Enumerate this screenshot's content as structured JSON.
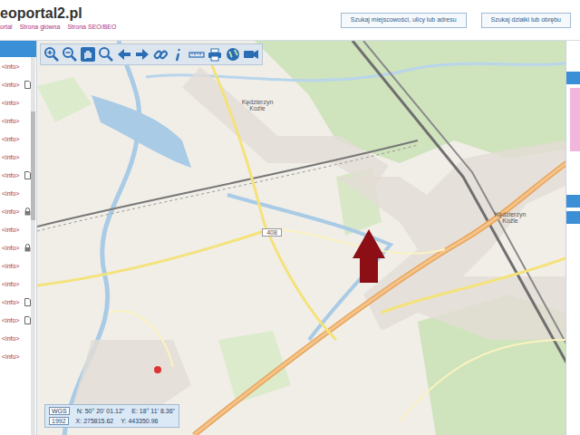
{
  "header": {
    "logo": "eoportal2.pl",
    "links": [
      "ortal",
      "Strona główna",
      "Strona SEO/BEO"
    ]
  },
  "search_buttons": [
    "Szukaj miejscowości, ulicy lub adresu",
    "Szukaj działki lub obrębu"
  ],
  "sidebar": {
    "items": [
      {
        "label": "<info>",
        "kind": "plain"
      },
      {
        "label": "<info>",
        "kind": "doc"
      },
      {
        "label": "<info>",
        "kind": "plain"
      },
      {
        "label": "<info>",
        "kind": "plain"
      },
      {
        "label": "<info>",
        "kind": "plain"
      },
      {
        "label": "<info>",
        "kind": "plain"
      },
      {
        "label": "<info>",
        "kind": "doc"
      },
      {
        "label": "<info>",
        "kind": "plain"
      },
      {
        "label": "<info>",
        "kind": "lock"
      },
      {
        "label": "<info>",
        "kind": "plain"
      },
      {
        "label": "<info>",
        "kind": "lock"
      },
      {
        "label": "<info>",
        "kind": "plain"
      },
      {
        "label": "<info>",
        "kind": "plain"
      },
      {
        "label": "<info>",
        "kind": "doc"
      },
      {
        "label": "<info>",
        "kind": "doc"
      },
      {
        "label": "<info>",
        "kind": "plain"
      },
      {
        "label": "<info>",
        "kind": "plain"
      }
    ]
  },
  "map": {
    "labels": [
      "Kędzierzyn Koźle",
      "Kędzierzyn Koźle",
      "408"
    ]
  },
  "coordinates": {
    "rows": [
      {
        "system": "WGS",
        "a": "N: 50° 20' 01.12\"",
        "b": "E: 18° 11' 8.36\""
      },
      {
        "system": "1992",
        "a": "X: 275815.62",
        "b": "Y: 443350.96"
      }
    ]
  }
}
